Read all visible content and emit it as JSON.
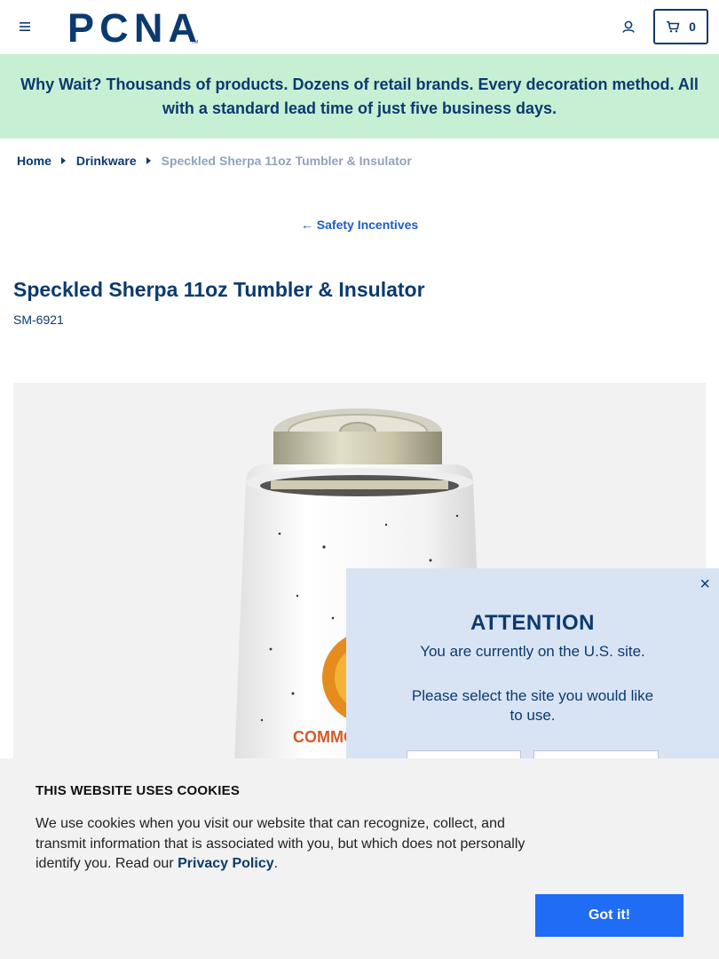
{
  "header": {
    "logo_text": "PCNA",
    "cart_count": "0"
  },
  "promo": {
    "text": "Why Wait? Thousands of products. Dozens of retail brands. Every decoration method. All with a standard lead time of just five business days."
  },
  "breadcrumb": {
    "items": [
      "Home",
      "Drinkware"
    ],
    "current": "Speckled Sherpa 11oz Tumbler & Insulator"
  },
  "back_link": {
    "arrow": "←",
    "label": "Safety Incentives"
  },
  "product": {
    "title": "Speckled Sherpa 11oz Tumbler & Insulator",
    "sku": "SM-6921",
    "image_text": "COMMON OUT"
  },
  "geo_popup": {
    "close": "×",
    "heading": "ATTENTION",
    "current_site": "You are currently on the U.S. site.",
    "prompt": "Please select the site you would like to use."
  },
  "cookie_banner": {
    "title": "THIS WEBSITE USES COOKIES",
    "text_before": "We use cookies when you visit our website that can recognize, collect, and transmit information that is associated with you, but which does not personally identify you. Read our ",
    "link": "Privacy Policy",
    "text_after": ".",
    "button": "Got it!"
  },
  "colors": {
    "navy": "#0b3a6e",
    "promo_bg": "#c7efd4",
    "link_blue": "#1a5ec8",
    "popup_bg": "#d8e4f4",
    "button_blue": "#1f6df4"
  },
  "icons": {
    "menu": "hamburger-icon",
    "user": "user-icon",
    "cart": "cart-icon"
  }
}
